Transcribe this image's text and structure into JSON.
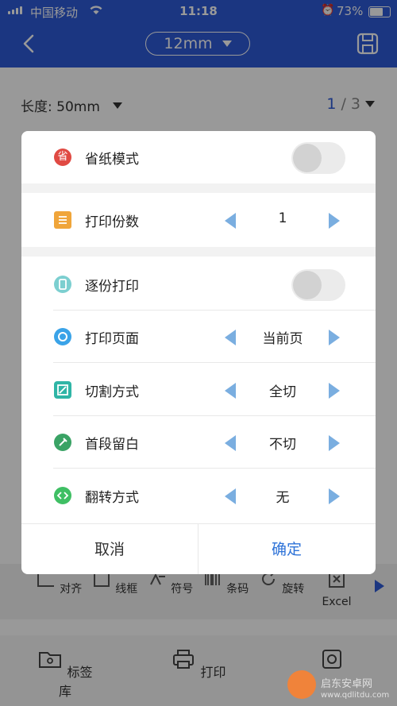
{
  "status_bar": {
    "carrier": "中国移动",
    "time": "11:18",
    "battery": "73%",
    "battery_level": 0.73
  },
  "header": {
    "tape_size": "12mm"
  },
  "toolbar": {
    "length_label": "长度: 50mm",
    "page_current": "1",
    "page_sep": "/",
    "page_total": "3"
  },
  "tools": [
    "对齐",
    "线框",
    "符号",
    "条码",
    "旋转",
    "Excel"
  ],
  "bottom_nav": [
    "标签库",
    "打印"
  ],
  "dialog": {
    "paper_save": {
      "label": "省纸模式",
      "on": false
    },
    "copies": {
      "label": "打印份数",
      "value": "1"
    },
    "collate": {
      "label": "逐份打印",
      "on": false
    },
    "print_page": {
      "label": "打印页面",
      "value": "当前页"
    },
    "cut_mode": {
      "label": "切割方式",
      "value": "全切"
    },
    "first_margin": {
      "label": "首段留白",
      "value": "不切"
    },
    "flip_mode": {
      "label": "翻转方式",
      "value": "无"
    },
    "cancel": "取消",
    "confirm": "确定"
  },
  "watermark": {
    "name": "启东安卓网",
    "url": "www.qdlitdu.com"
  },
  "colors": {
    "header_blue": "#2e5ad8",
    "accent": "#2e73d8",
    "stepper_arrow": "#7aaee0",
    "paper_save_icon": "#e04a43",
    "copies_icon": "#f0a53a",
    "collate_icon": "#7ccfd0",
    "print_page_icon": "#3aa3e8",
    "cut_icon": "#2fb5a6",
    "margin_icon": "#3aa365",
    "flip_icon": "#3fbf64"
  }
}
